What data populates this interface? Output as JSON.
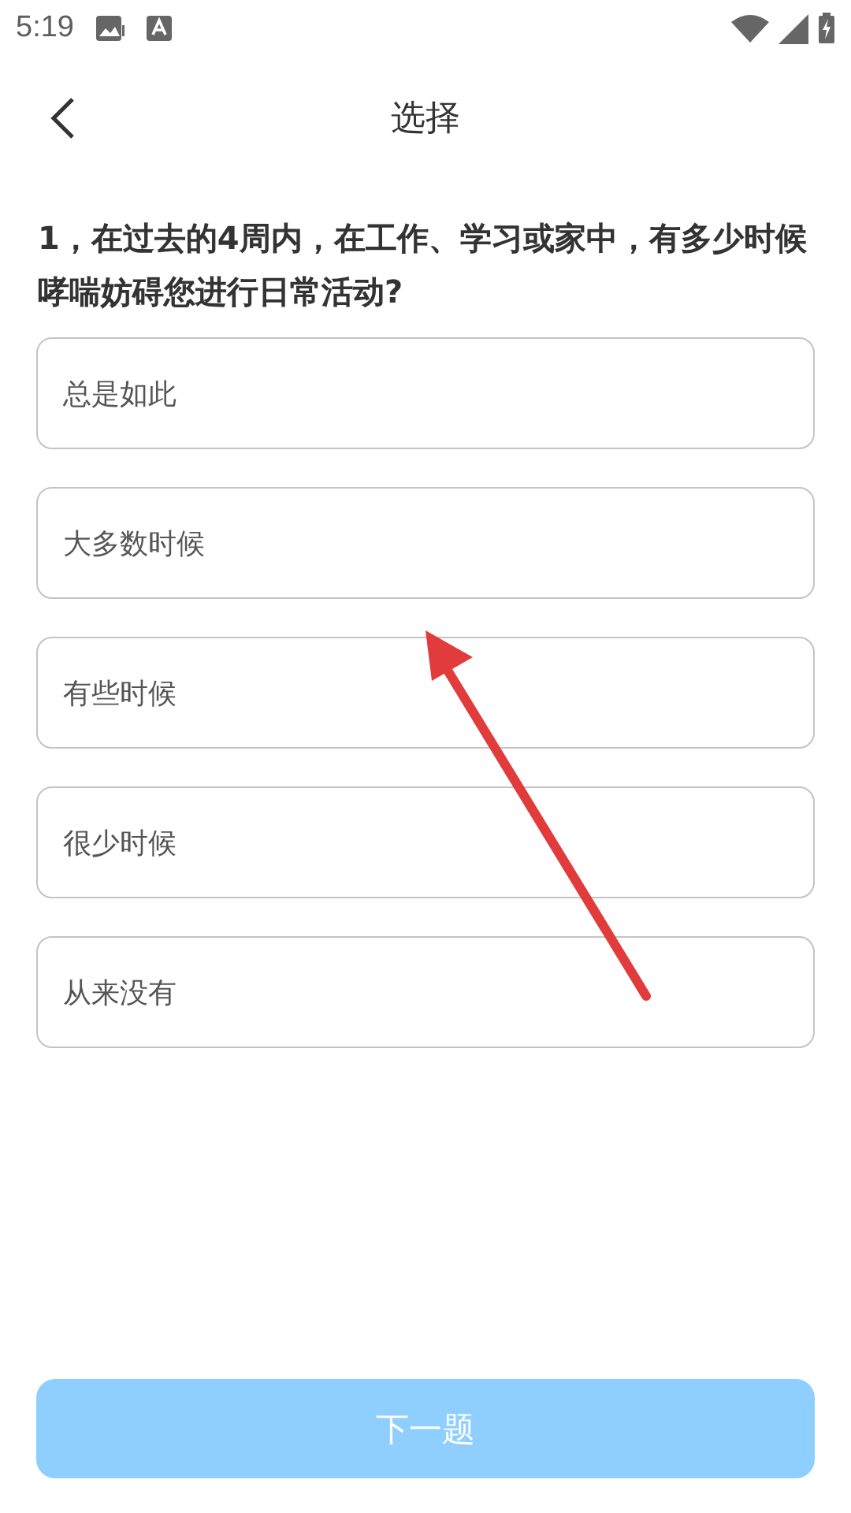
{
  "status_bar": {
    "time": "5:19"
  },
  "header": {
    "title": "选择"
  },
  "question": {
    "text": "**1**，在过去的**4**周内，在工作、学习或家中，有多少时候哮喘妨碍您进行日常活动?"
  },
  "options": [
    {
      "label": "总是如此",
      "selected": false
    },
    {
      "label": "大多数时候",
      "selected": false
    },
    {
      "label": "有些时候",
      "selected": false
    },
    {
      "label": "很少时候",
      "selected": false
    },
    {
      "label": "从来没有",
      "selected": false
    }
  ],
  "next_button": {
    "label": "下一题",
    "disabled": true
  }
}
